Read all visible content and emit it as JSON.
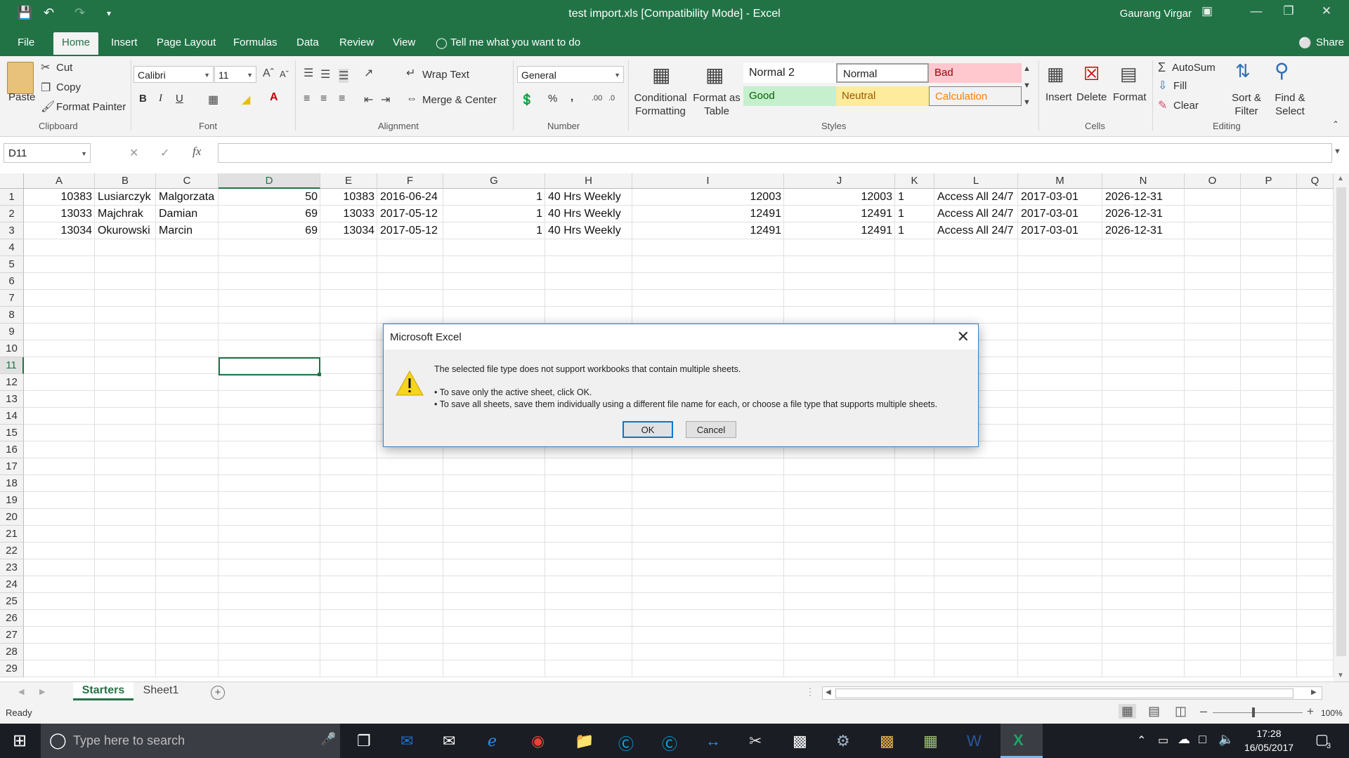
{
  "titlebar": {
    "title": "test import.xls  [Compatibility Mode]  -  Excel",
    "user": "Gaurang Virgar"
  },
  "tabs": [
    "File",
    "Home",
    "Insert",
    "Page Layout",
    "Formulas",
    "Data",
    "Review",
    "View"
  ],
  "tell_me": "Tell me what you want to do",
  "share": "Share",
  "ribbon": {
    "clipboard": {
      "paste": "Paste",
      "cut": "Cut",
      "copy": "Copy",
      "format_painter": "Format Painter",
      "group": "Clipboard"
    },
    "font": {
      "name": "Calibri",
      "size": "11",
      "group": "Font",
      "bold": "B",
      "italic": "I",
      "underline": "U"
    },
    "alignment": {
      "wrap": "Wrap Text",
      "merge": "Merge & Center",
      "group": "Alignment"
    },
    "number": {
      "format": "General",
      "percent": "%",
      "comma": ",",
      "group": "Number"
    },
    "styles": {
      "conditional": "Conditional Formatting",
      "format_as_table": "Format as Table",
      "items": [
        "Normal 2",
        "Normal",
        "Bad",
        "Good",
        "Neutral",
        "Calculation"
      ],
      "group": "Styles"
    },
    "cells": {
      "insert": "Insert",
      "delete": "Delete",
      "format": "Format",
      "group": "Cells"
    },
    "editing": {
      "autosum": "AutoSum",
      "fill": "Fill",
      "clear": "Clear",
      "sort": "Sort & Filter",
      "find": "Find & Select",
      "group": "Editing"
    }
  },
  "namebox": "D11",
  "fx": "fx",
  "columns": [
    "A",
    "B",
    "C",
    "D",
    "E",
    "F",
    "G",
    "H",
    "I",
    "J",
    "K",
    "L",
    "M",
    "N",
    "O",
    "P",
    "Q"
  ],
  "rows": [
    [
      "10383",
      "Lusiarczyk",
      "Malgorzata",
      "50",
      "10383",
      "2016-06-24",
      "1",
      "40 Hrs Weekly",
      "12003",
      "12003",
      "1",
      "Access All 24/7",
      "2017-03-01",
      "2026-12-31"
    ],
    [
      "13033",
      "Majchrak",
      "Damian",
      "69",
      "13033",
      "2017-05-12",
      "1",
      "40 Hrs Weekly",
      "12491",
      "12491",
      "1",
      "Access All 24/7",
      "2017-03-01",
      "2026-12-31"
    ],
    [
      "13034",
      "Okurowski",
      "Marcin",
      "69",
      "13034",
      "2017-05-12",
      "1",
      "40 Hrs Weekly",
      "12491",
      "12491",
      "1",
      "Access All 24/7",
      "2017-03-01",
      "2026-12-31"
    ]
  ],
  "row_numbers": [
    "1",
    "2",
    "3",
    "4",
    "5",
    "6",
    "7",
    "8",
    "9",
    "10",
    "11",
    "12",
    "13",
    "14",
    "15",
    "16",
    "17",
    "18",
    "19",
    "20",
    "21",
    "22",
    "23",
    "24",
    "25",
    "26",
    "27",
    "28",
    "29"
  ],
  "sheets": [
    "Starters",
    "Sheet1"
  ],
  "status": {
    "ready": "Ready",
    "zoom": "100%"
  },
  "dialog": {
    "title": "Microsoft Excel",
    "line1": "The selected file type does not support workbooks that contain multiple sheets.",
    "line2": "• To save only the active sheet, click OK.",
    "line3": "• To save all sheets, save them individually using a different file name for each, or choose a file type that supports multiple sheets.",
    "ok": "OK",
    "cancel": "Cancel"
  },
  "taskbar": {
    "search": "Type here to search",
    "time": "17:28",
    "date": "16/05/2017",
    "notifications": "3"
  }
}
